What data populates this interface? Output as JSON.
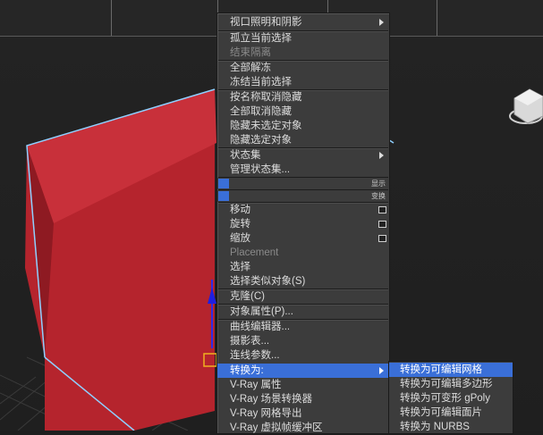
{
  "menu": {
    "items": [
      {
        "label": "视口照明和阴影",
        "submenu": true
      },
      {
        "label": "孤立当前选择"
      },
      {
        "label": "结束隔离",
        "disabled": true
      },
      {
        "label": "全部解冻"
      },
      {
        "label": "冻结当前选择"
      },
      {
        "label": "按名称取消隐藏"
      },
      {
        "label": "全部取消隐藏"
      },
      {
        "label": "隐藏未选定对象"
      },
      {
        "label": "隐藏选定对象"
      },
      {
        "label": "状态集",
        "submenu": true
      },
      {
        "label": "管理状态集..."
      },
      {
        "label": "移动"
      },
      {
        "label": "旋转"
      },
      {
        "label": "缩放"
      },
      {
        "label": "Placement",
        "disabled": true
      },
      {
        "label": "选择"
      },
      {
        "label": "选择类似对象(S)"
      },
      {
        "label": "克隆(C)"
      },
      {
        "label": "对象属性(P)..."
      },
      {
        "label": "曲线编辑器..."
      },
      {
        "label": "摄影表..."
      },
      {
        "label": "连线参数..."
      },
      {
        "label": "转换为:",
        "submenu": true
      },
      {
        "label": "V-Ray 属性"
      },
      {
        "label": "V-Ray 场景转换器"
      },
      {
        "label": "V-Ray 网格导出"
      },
      {
        "label": "V-Ray 虚拟帧缓冲区"
      }
    ],
    "quad_labels": {
      "display": "显示",
      "transform": "变换"
    }
  },
  "submenu": {
    "items": [
      "转换为可编辑网格",
      "转换为可编辑多边形",
      "转换为可变形 gPoly",
      "转换为可编辑面片",
      "转换为 NURBS"
    ]
  },
  "colors": {
    "accent": "#3a6fd8",
    "box_red": "#c02a33",
    "menu_bg": "#3c3c3c",
    "edge_highlight": "#7ec3ff"
  }
}
